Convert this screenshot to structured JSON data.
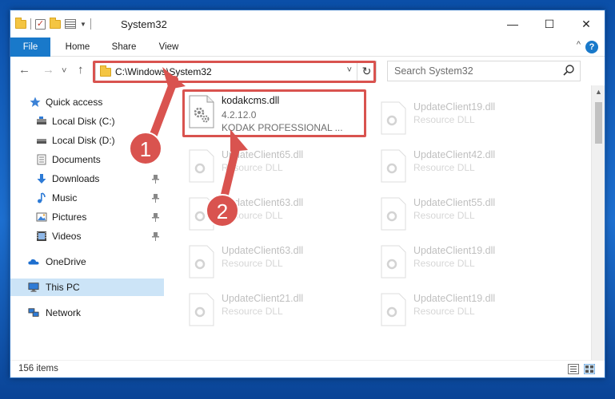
{
  "window": {
    "title": "System32",
    "controls": {
      "minimize": "—",
      "maximize": "☐",
      "close": "✕"
    }
  },
  "ribbon": {
    "tabs": [
      "File",
      "Home",
      "Share",
      "View"
    ],
    "help": "?",
    "collapse": "^"
  },
  "nav": {
    "back": "←",
    "forward": "→",
    "recent": "˅",
    "up": "↑",
    "address": "C:\\Windows\\System32",
    "address_dropdown": "˅",
    "refresh": "↻",
    "search_placeholder": "Search System32"
  },
  "sidebar": {
    "items": [
      {
        "label": "Quick access",
        "icon": "star-icon"
      },
      {
        "label": "Local Disk (C:)",
        "icon": "drive-icon"
      },
      {
        "label": "Local Disk (D:)",
        "icon": "drive-icon"
      },
      {
        "label": "Documents",
        "icon": "documents-icon"
      },
      {
        "label": "Downloads",
        "icon": "download-icon"
      },
      {
        "label": "Music",
        "icon": "music-icon"
      },
      {
        "label": "Pictures",
        "icon": "pictures-icon"
      },
      {
        "label": "Videos",
        "icon": "videos-icon"
      },
      {
        "label": "OneDrive",
        "icon": "cloud-icon"
      },
      {
        "label": "This PC",
        "icon": "computer-icon"
      },
      {
        "label": "Network",
        "icon": "network-icon"
      }
    ],
    "pin": "📌"
  },
  "files": {
    "primary": {
      "name": "kodakcms.dll",
      "version": "4.2.12.0",
      "company": "KODAK PROFESSIONAL ..."
    },
    "ghost": [
      {
        "name": "UpdateClient19.dll",
        "type": "Resource DLL"
      },
      {
        "name": "UpdateClient65.dll",
        "type": "Resource DLL"
      },
      {
        "name": "UpdateClient42.dll",
        "type": "Resource DLL"
      },
      {
        "name": "UpdateClient63.dll",
        "type": "Resource DLL"
      },
      {
        "name": "UpdateClient55.dll",
        "type": "Resource DLL"
      },
      {
        "name": "UpdateClient63.dll",
        "type": "Resource DLL"
      },
      {
        "name": "UpdateClient19.dll",
        "type": "Resource DLL"
      },
      {
        "name": "UpdateClient21.dll",
        "type": "Resource DLL"
      },
      {
        "name": "UpdateClient19.dll",
        "type": "Resource DLL"
      }
    ]
  },
  "status": {
    "count": "156 items"
  },
  "annotations": {
    "step1": "1",
    "step2": "2",
    "color": "#d9534f"
  }
}
